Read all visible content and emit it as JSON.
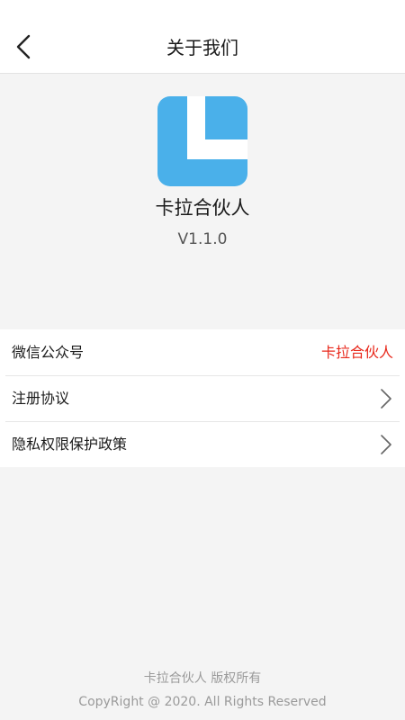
{
  "header": {
    "title": "关于我们",
    "back_icon": "chevron-left-icon"
  },
  "app": {
    "logo_icon": "app-logo-icon",
    "logo_color": "#4ab0ea",
    "name": "卡拉合伙人",
    "version": "V1.1.0"
  },
  "menu": {
    "items": [
      {
        "label": "微信公众号",
        "value": "卡拉合伙人",
        "value_color": "#e8291c"
      },
      {
        "label": "注册协议",
        "icon": "chevron-right-icon"
      },
      {
        "label": "隐私权限保护政策",
        "icon": "chevron-right-icon"
      }
    ]
  },
  "footer": {
    "line1": "卡拉合伙人 版权所有",
    "line2": "CopyRight @ 2020. All Rights Reserved"
  }
}
